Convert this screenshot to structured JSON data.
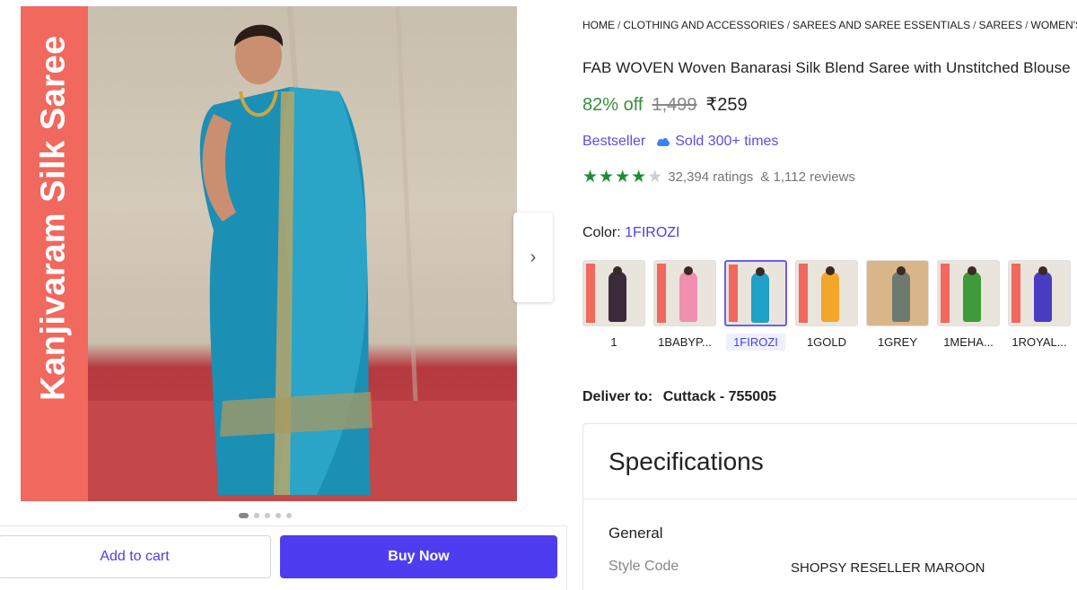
{
  "gallery": {
    "banner_text": "Kanjivaram Silk Saree",
    "dots_count": 5,
    "active_dot": 0
  },
  "actions": {
    "add_to_cart": "Add to cart",
    "buy_now": "Buy Now"
  },
  "breadcrumb": [
    "HOME",
    "CLOTHING AND ACCESSORIES",
    "SAREES AND SAREE ESSENTIALS",
    "SAREES",
    "WOMEN'S SAREES"
  ],
  "product": {
    "title": "FAB WOVEN Woven Banarasi Silk Blend Saree with Unstitched Blouse",
    "discount": "82% off",
    "mrp": "1,499",
    "price": "₹259",
    "bestseller": "Bestseller",
    "sold": "Sold 300+ times",
    "rating": 4,
    "ratings_text": "32,394 ratings",
    "reviews_text": "& 1,112 reviews"
  },
  "color": {
    "label": "Color:",
    "selected": "1FIROZI",
    "options": [
      {
        "label": "1",
        "color": "#3b2a3a"
      },
      {
        "label": "1BABYP...",
        "color": "#f08fb0"
      },
      {
        "label": "1FIROZI",
        "color": "#1ea0c8"
      },
      {
        "label": "1GOLD",
        "color": "#f3a62a"
      },
      {
        "label": "1GREY",
        "color": "#6f7a6e"
      },
      {
        "label": "1MEHA...",
        "color": "#3f9a3a"
      },
      {
        "label": "1ROYAL...",
        "color": "#4a3cc0"
      }
    ]
  },
  "delivery": {
    "label": "Deliver to:",
    "location": "Cuttack - 755005"
  },
  "specs": {
    "heading": "Specifications",
    "section": "General",
    "rows": [
      {
        "key": "Style Code",
        "value": "SHOPSY RESELLER MAROON"
      }
    ]
  },
  "colors": {
    "accent": "#4e3df0",
    "discount_green": "#388e3c",
    "star_green": "#1a8f3a",
    "banner": "#f0685e"
  }
}
